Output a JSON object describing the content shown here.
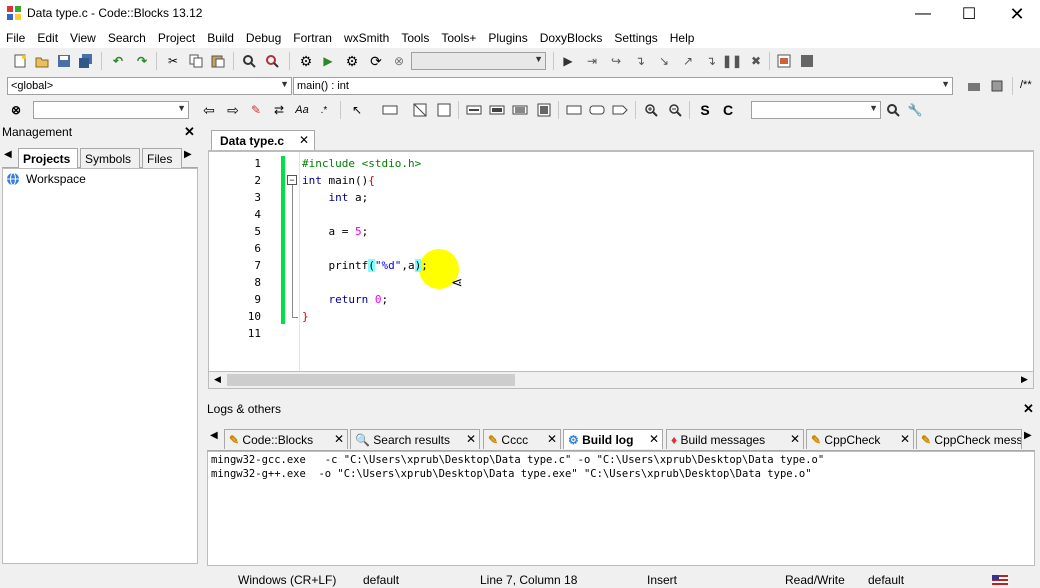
{
  "window": {
    "title": "Data type.c - Code::Blocks 13.12"
  },
  "menu": [
    "File",
    "Edit",
    "View",
    "Search",
    "Project",
    "Build",
    "Debug",
    "Fortran",
    "wxSmith",
    "Tools",
    "Tools+",
    "Plugins",
    "DoxyBlocks",
    "Settings",
    "Help"
  ],
  "codebar": {
    "scope": "<global>",
    "symbol": "main() : int",
    "comment_btn": "/**"
  },
  "management": {
    "title": "Management",
    "tabs": [
      "Projects",
      "Symbols",
      "Files"
    ],
    "workspace": "Workspace"
  },
  "editor": {
    "tab": "Data type.c",
    "lines": [
      "1",
      "2",
      "3",
      "4",
      "5",
      "6",
      "7",
      "8",
      "9",
      "10",
      "11"
    ]
  },
  "logs": {
    "title": "Logs & others",
    "tabs": [
      "Code::Blocks",
      "Search results",
      "Cccc",
      "Build log",
      "Build messages",
      "CppCheck",
      "CppCheck messa"
    ],
    "output": [
      "mingw32-gcc.exe   -c \"C:\\Users\\xprub\\Desktop\\Data type.c\" -o \"C:\\Users\\xprub\\Desktop\\Data type.o\"",
      "mingw32-g++.exe  -o \"C:\\Users\\xprub\\Desktop\\Data type.exe\" \"C:\\Users\\xprub\\Desktop\\Data type.o\""
    ]
  },
  "status": {
    "eol": "Windows (CR+LF)",
    "encoding": "default",
    "position": "Line 7, Column 18",
    "mode": "Insert",
    "access": "Read/Write",
    "lang": "default"
  },
  "colors": {
    "keyword": "#00008b",
    "string": "#0000ff",
    "number": "#f000f0",
    "preproc": "#008000",
    "brace_hl": "#80ffff",
    "cursor_hl": "#ffff00",
    "change_bar": "#00e040"
  }
}
